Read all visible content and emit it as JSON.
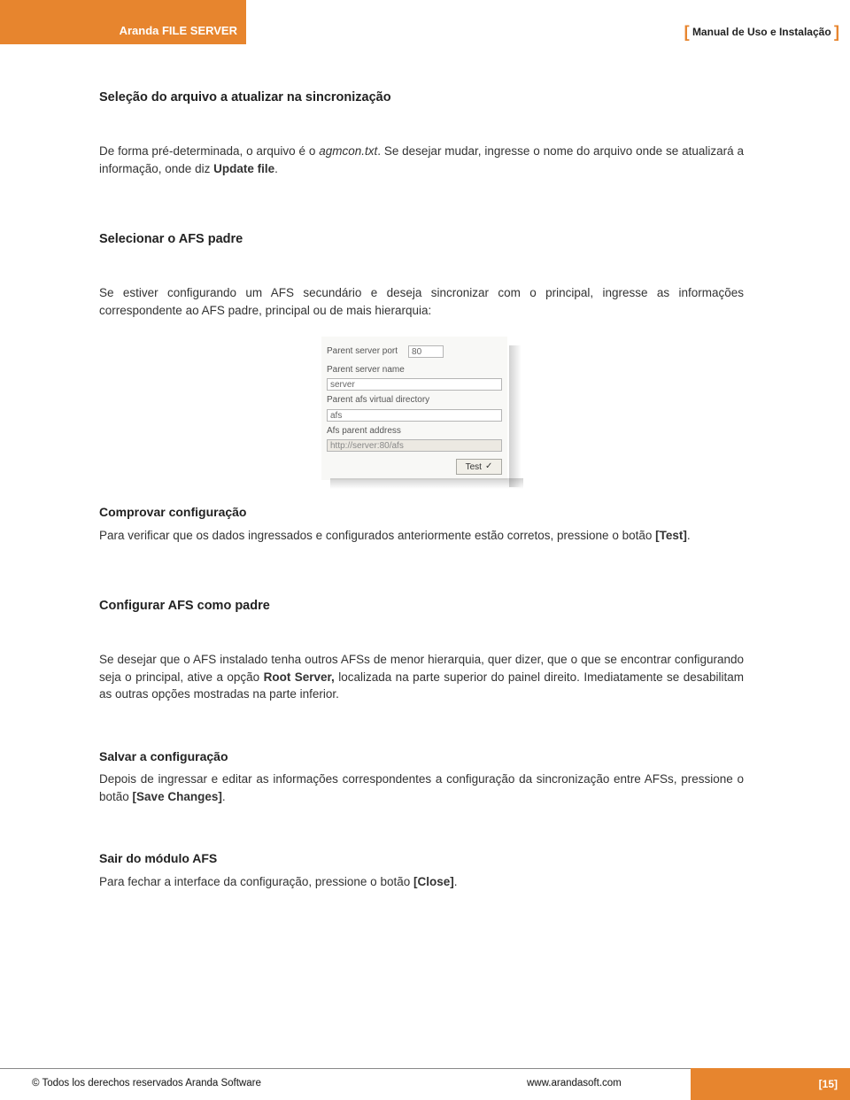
{
  "header": {
    "product": "Aranda FILE SERVER",
    "doc_label": "Manual de Uso e Instalação"
  },
  "sections": {
    "s1": {
      "title": "Seleção do arquivo a atualizar na sincronização",
      "p_before_em": "De forma pré-determinada, o arquivo é o ",
      "p_em": "agmcon.txt",
      "p_after_em": ". Se desejar mudar, ingresse o nome do arquivo onde se atualizará a informação, onde diz ",
      "p_bold": "Update file",
      "p_tail": "."
    },
    "s2": {
      "title": "Selecionar o AFS padre",
      "p": "Se estiver configurando um AFS secundário e deseja sincronizar com o principal, ingresse as informações correspondente ao AFS padre, principal ou de mais hierarquia:"
    },
    "shot": {
      "lbl_port": "Parent server port",
      "val_port": "80",
      "lbl_name": "Parent server name",
      "val_name": "server",
      "lbl_vdir": "Parent afs virtual directory",
      "val_vdir": "afs",
      "lbl_addr": "Afs parent address",
      "val_addr": "http://server:80/afs",
      "btn_test": "Test"
    },
    "s3": {
      "title": "Comprovar configuração",
      "p_before": "Para verificar que os dados ingressados e configurados anteriormente estão corretos, pressione o botão ",
      "p_bold": "[Test]",
      "p_tail": "."
    },
    "s4": {
      "title": "Configurar AFS como padre",
      "p_before": "Se desejar que o AFS instalado tenha outros AFSs de menor hierarquia, quer dizer, que o que se encontrar configurando seja o principal, ative a opção ",
      "p_bold": "Root Server,",
      "p_after": " localizada na parte superior do painel direito. Imediatamente se desabilitam as outras opções mostradas na parte inferior."
    },
    "s5": {
      "title": "Salvar a configuração",
      "p_before": "Depois de ingressar e editar as informações correspondentes a configuração da sincronização entre AFSs, pressione o botão ",
      "p_bold": "[Save Changes]",
      "p_tail": "."
    },
    "s6": {
      "title": "Sair do módulo AFS",
      "p_before": "Para fechar a interface da configuração, pressione o botão ",
      "p_bold": "[Close]",
      "p_tail": "."
    }
  },
  "footer": {
    "copyright": "© Todos los derechos reservados Aranda Software",
    "url": "www.arandasoft.com",
    "page": "[15]"
  }
}
